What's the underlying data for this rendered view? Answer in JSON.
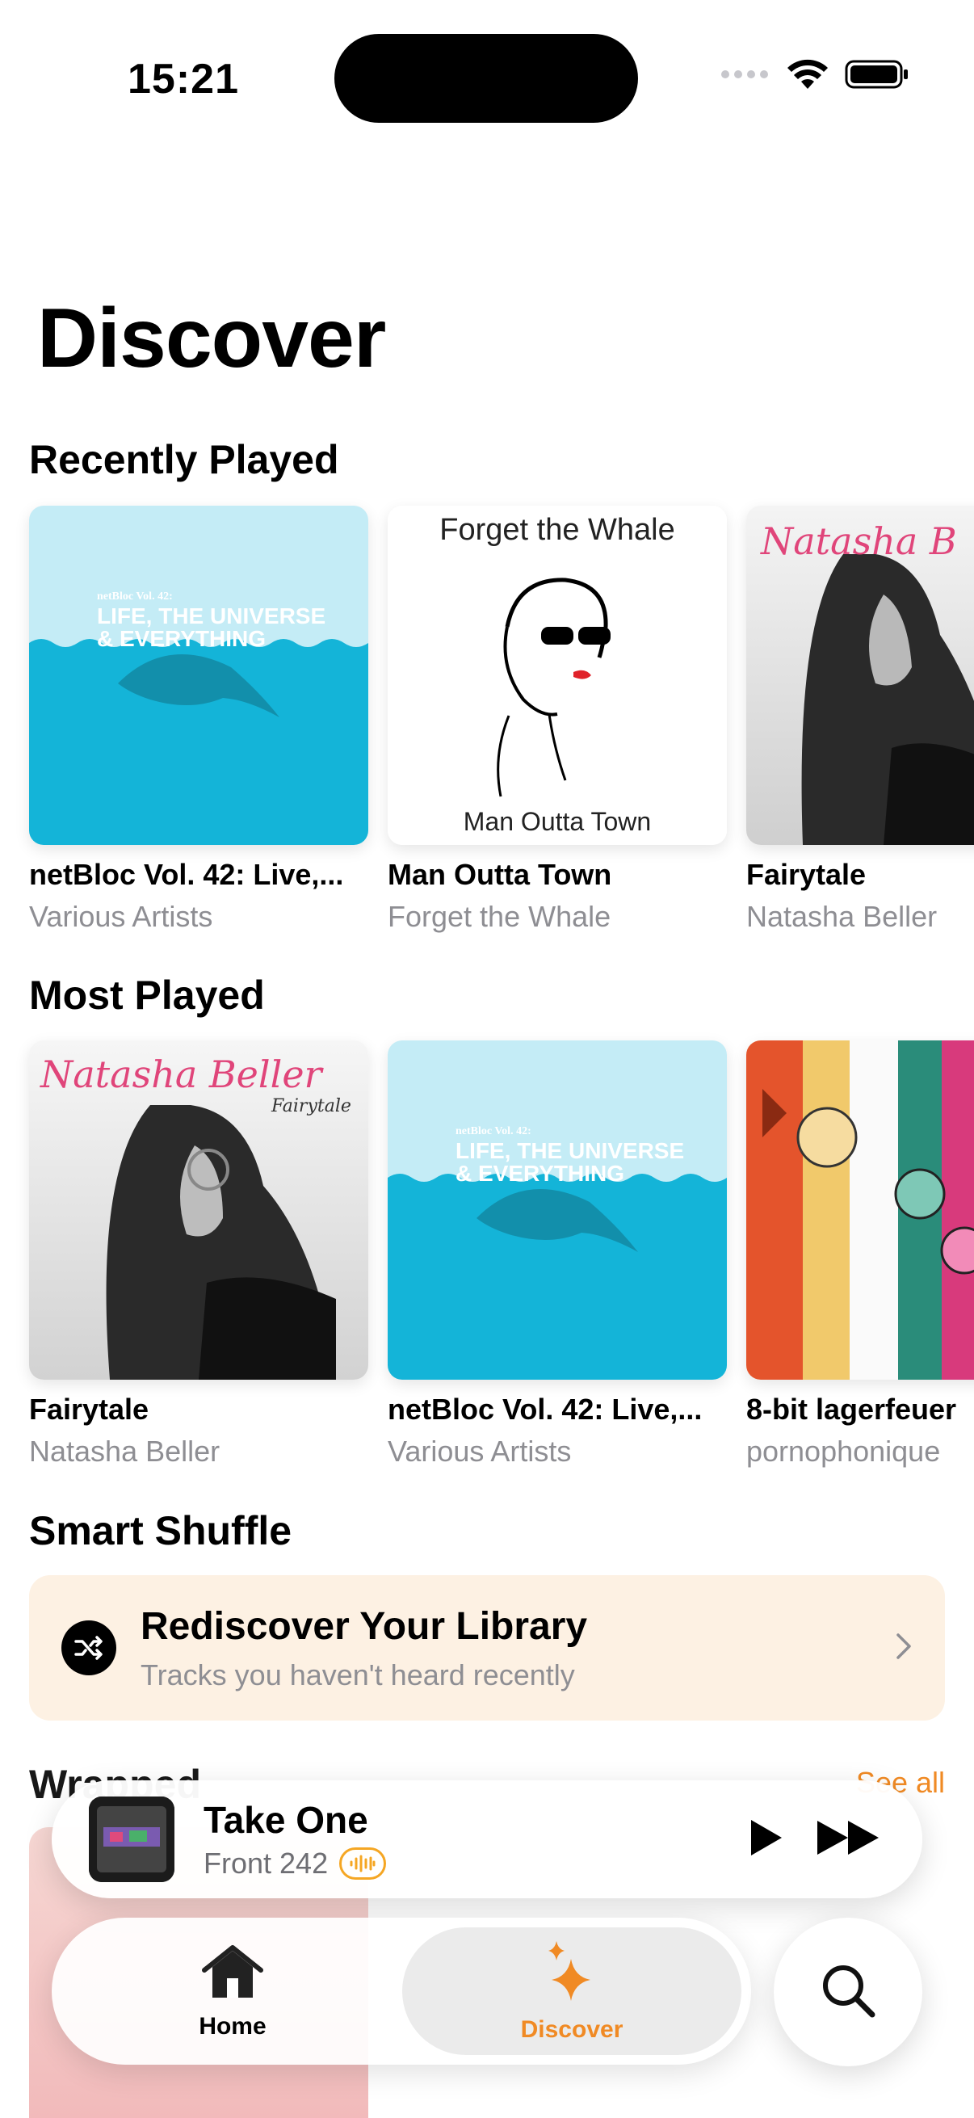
{
  "status": {
    "time": "15:21"
  },
  "page_title": "Discover",
  "recently_played": {
    "heading": "Recently Played",
    "items": [
      {
        "title": "netBloc Vol. 42: Live,...",
        "artist": "Various Artists",
        "art_text1": "netBloc Vol. 42:",
        "art_text2": "LIFE, THE UNIVERSE",
        "art_text3": "& EVERYTHING"
      },
      {
        "title": "Man Outta Town",
        "artist": "Forget the Whale",
        "art_top": "Forget the Whale",
        "art_bottom": "Man Outta Town"
      },
      {
        "title": "Fairytale",
        "artist": "Natasha Beller",
        "art_script": "Natasha B"
      }
    ]
  },
  "most_played": {
    "heading": "Most Played",
    "items": [
      {
        "title": "Fairytale",
        "artist": "Natasha Beller",
        "art_script": "Natasha Beller",
        "art_sub": "Fairytale"
      },
      {
        "title": "netBloc Vol. 42: Live,...",
        "artist": "Various Artists",
        "art_text1": "netBloc Vol. 42:",
        "art_text2": "LIFE, THE UNIVERSE",
        "art_text3": "& EVERYTHING"
      },
      {
        "title": "8-bit lagerfeuer",
        "artist": "pornophonique"
      }
    ]
  },
  "smart_shuffle": {
    "heading": "Smart Shuffle",
    "title": "Rediscover Your Library",
    "subtitle": "Tracks you haven't heard recently"
  },
  "wrapped": {
    "heading": "Wrapped",
    "see_all": "See all"
  },
  "now_playing": {
    "title": "Take One",
    "artist": "Front 242"
  },
  "tabs": [
    {
      "label": "Home",
      "icon": "house-icon"
    },
    {
      "label": "Discover",
      "icon": "sparkles-icon",
      "active": true
    }
  ],
  "colors": {
    "accent": "#f08a24",
    "shuffle_bg": "#fdf1e3",
    "ocean": "#14b4d8"
  }
}
